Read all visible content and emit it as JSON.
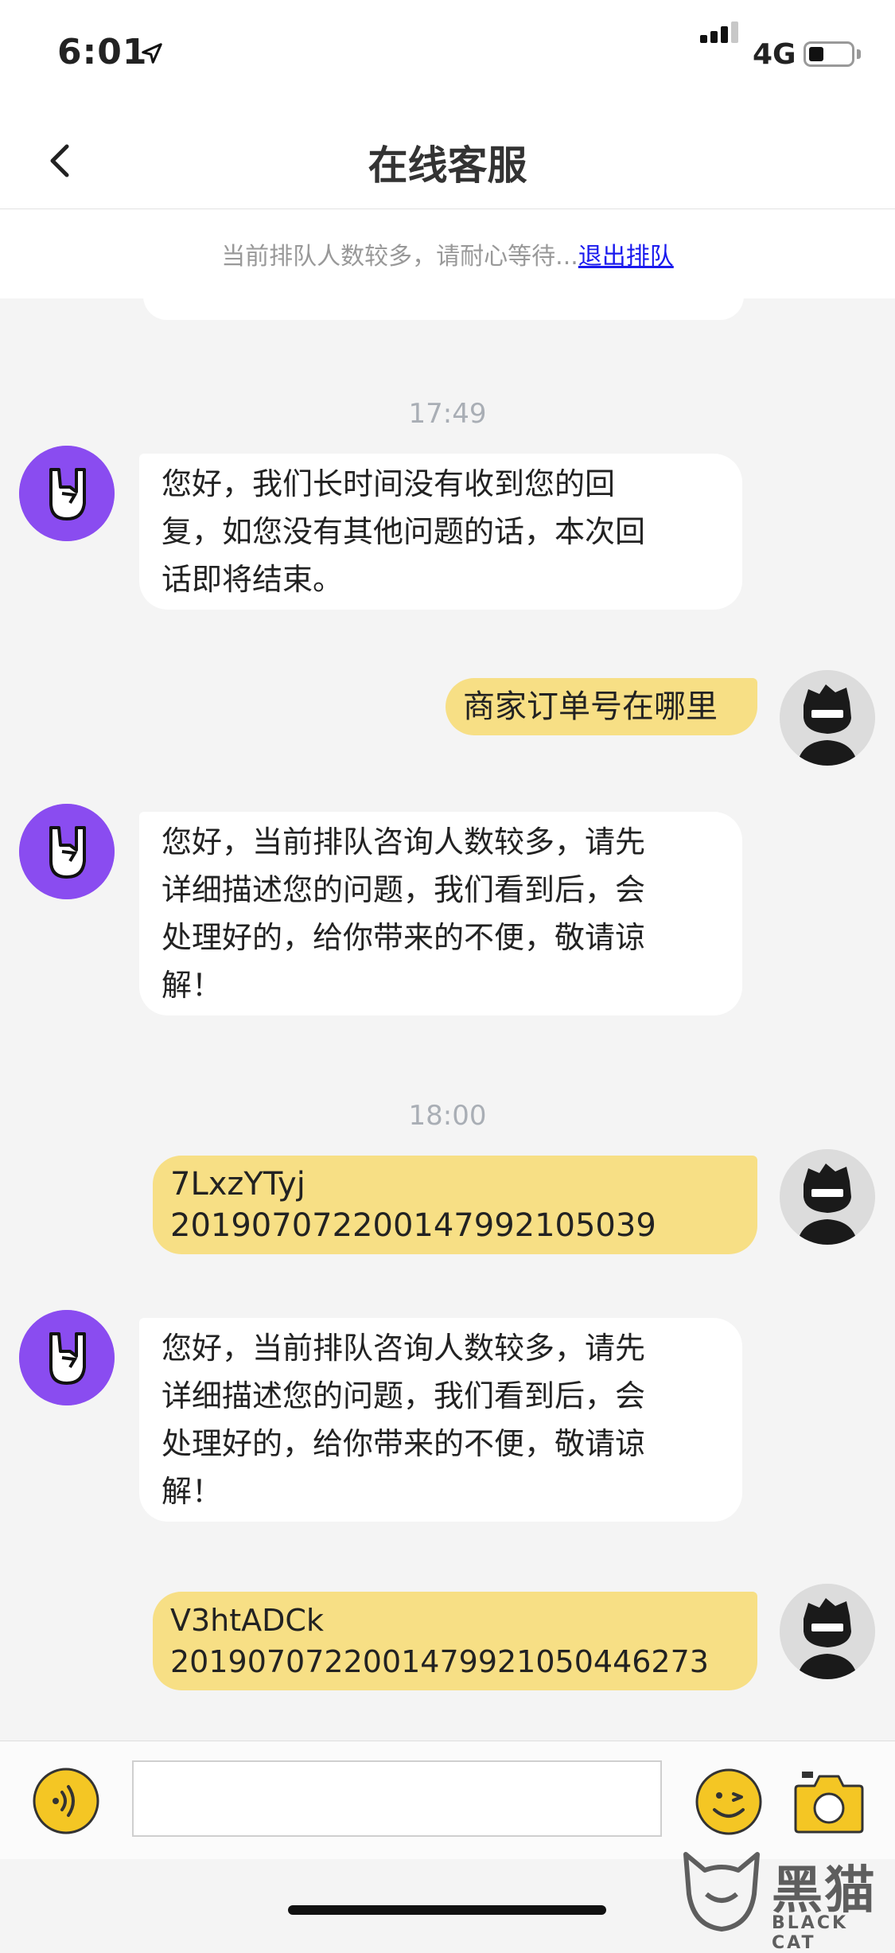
{
  "status_bar": {
    "time": "6:01",
    "network": "4G",
    "battery_level": 0.35
  },
  "nav": {
    "title": "在线客服"
  },
  "queue_banner": {
    "text": "当前排队人数较多，请耐心等待...",
    "exit_link": "退出排队"
  },
  "timestamps": {
    "t1": "17:49",
    "t2": "18:00"
  },
  "messages": [
    {
      "sender": "agent",
      "text": "您好，我们长时间没有收到您的回\n复，如您没有其他问题的话，本次回\n话即将结束。"
    },
    {
      "sender": "user",
      "text": "商家订单号在哪里"
    },
    {
      "sender": "agent",
      "text": "您好，当前排队咨询人数较多，请先\n详细描述您的问题，我们看到后，会\n处理好的，给你带来的不便，敬请谅\n解！"
    },
    {
      "sender": "user",
      "text": "7LxzYTyj\n2019070722001479921050​39"
    },
    {
      "sender": "agent",
      "text": "您好，当前排队咨询人数较多，请先\n详细描述您的问题，我们看到后，会\n处理好的，给你带来的不便，敬请谅\n解！"
    },
    {
      "sender": "user",
      "text": "V3htADCk\n2019070722001479921050446273"
    }
  ],
  "input_bar": {
    "placeholder": "",
    "value": ""
  },
  "icons": {
    "back": "chevron-left-icon",
    "voice": "voice-icon",
    "emoji": "emoji-icon",
    "camera": "camera-icon",
    "location": "location-arrow-icon"
  },
  "colors": {
    "accent": "#f7df85",
    "button": "#f4c624",
    "agent_avatar": "#8a4cf0"
  },
  "watermark": {
    "text": "黑猫",
    "sub": "BLACK CAT"
  }
}
